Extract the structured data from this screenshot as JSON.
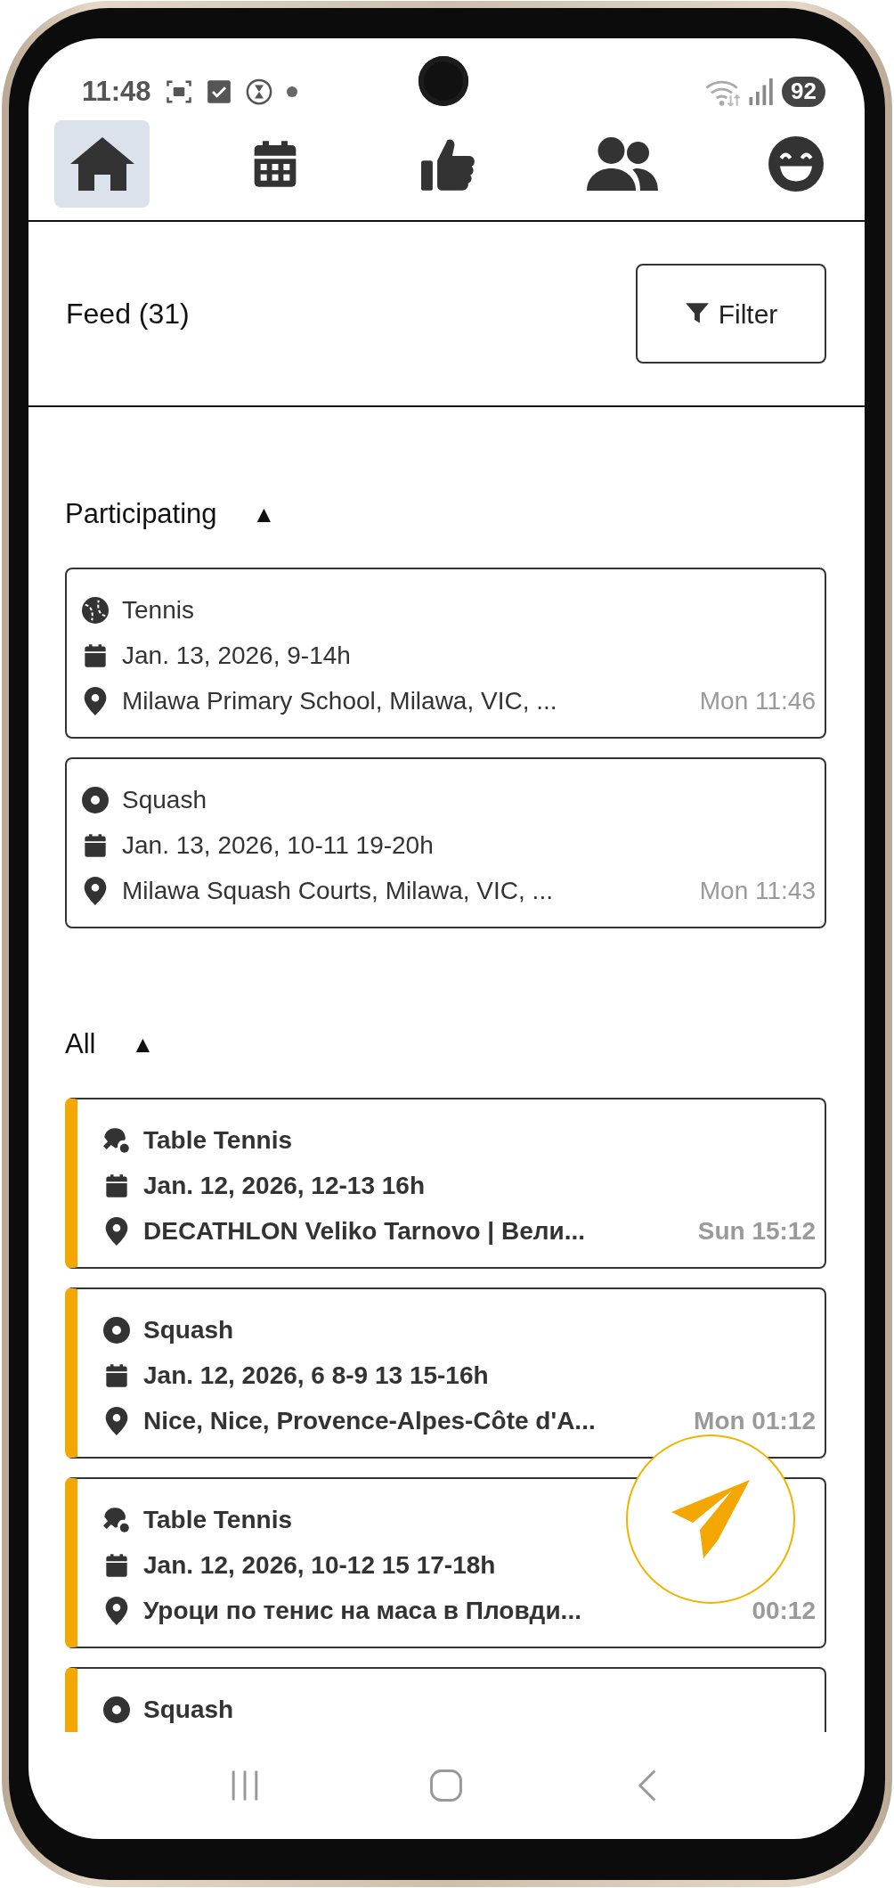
{
  "status_bar": {
    "time": "11:48",
    "battery": "92"
  },
  "tabs": [
    {
      "selected": true
    },
    {
      "selected": false
    },
    {
      "selected": false
    },
    {
      "selected": false
    },
    {
      "selected": false
    }
  ],
  "header": {
    "title": "Feed (31)",
    "filter_button": "Filter"
  },
  "sections": [
    {
      "title": "Participating",
      "toggle": "▲",
      "events": [
        {
          "kind": "tennis",
          "sport": "Tennis",
          "date": "Jan. 13, 2026, 9-14h",
          "location": "Milawa Primary School, Milawa, VIC, ...",
          "time": "Mon 11:46",
          "unread": false
        },
        {
          "kind": "squash",
          "sport": "Squash",
          "date": "Jan. 13, 2026, 10-11 19-20h",
          "location": "Milawa Squash Courts, Milawa, VIC, ...",
          "time": "Mon 11:43",
          "unread": false
        }
      ]
    },
    {
      "title": "All",
      "toggle": "▲",
      "events": [
        {
          "kind": "table_tennis",
          "sport": "Table Tennis",
          "date": "Jan. 12, 2026, 12-13 16h",
          "location": "DECATHLON Veliko Tarnovo | Вели...",
          "time": "Sun 15:12",
          "unread": true
        },
        {
          "kind": "squash",
          "sport": "Squash",
          "date": "Jan. 12, 2026, 6 8-9 13 15-16h",
          "location": "Nice, Nice, Provence-Alpes-Côte d'A...",
          "time": "Mon 01:12",
          "unread": true
        },
        {
          "kind": "table_tennis",
          "sport": "Table Tennis",
          "date": "Jan. 12, 2026, 10-12 15 17-18h",
          "location": "Уроци по тенис на маса в Пловди...",
          "time": "00:12",
          "unread": true
        },
        {
          "kind": "squash",
          "sport": "Squash",
          "unread": true
        }
      ]
    }
  ]
}
